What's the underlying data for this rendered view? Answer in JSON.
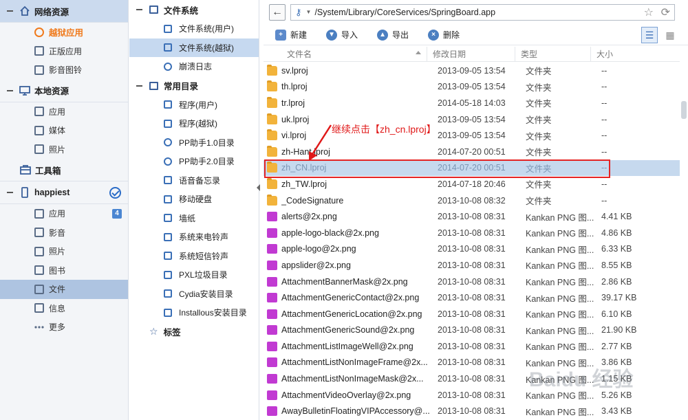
{
  "sidebar": {
    "sections": [
      {
        "label": "网络资源",
        "items": [
          "越狱应用",
          "正版应用",
          "影音图铃"
        ]
      },
      {
        "label": "本地资源",
        "items": [
          "应用",
          "媒体",
          "照片"
        ]
      },
      {
        "label": "工具箱",
        "items": []
      },
      {
        "label": "happiest",
        "items": [
          "应用",
          "影音",
          "照片",
          "图书",
          "文件",
          "信息",
          "更多"
        ],
        "badge": "4"
      }
    ]
  },
  "tree": {
    "filesystem_label": "文件系统",
    "filesystem_items": [
      "文件系统(用户)",
      "文件系统(越狱)",
      "崩溃日志"
    ],
    "common_label": "常用目录",
    "common_items": [
      "程序(用户)",
      "程序(越狱)",
      "PP助手1.0目录",
      "PP助手2.0目录",
      "语音备忘录",
      "移动硬盘",
      "墙纸",
      "系统来电铃声",
      "系统短信铃声",
      "PXL垃圾目录",
      "Cydia安装目录",
      "Installous安装目录"
    ],
    "bookmarks_label": "标签"
  },
  "address": {
    "path": "/System/Library/CoreServices/SpringBoard.app"
  },
  "toolbar": {
    "new_label": "新建",
    "import_label": "导入",
    "export_label": "导出",
    "delete_label": "删除"
  },
  "columns": {
    "name": "文件名",
    "date": "修改日期",
    "type": "类型",
    "size": "大小"
  },
  "files": [
    {
      "name": "sv.lproj",
      "date": "2013-09-05 13:54",
      "type": "文件夹",
      "size": "--",
      "kind": "folder"
    },
    {
      "name": "th.lproj",
      "date": "2013-09-05 13:54",
      "type": "文件夹",
      "size": "--",
      "kind": "folder"
    },
    {
      "name": "tr.lproj",
      "date": "2014-05-18 14:03",
      "type": "文件夹",
      "size": "--",
      "kind": "folder"
    },
    {
      "name": "uk.lproj",
      "date": "2013-09-05 13:54",
      "type": "文件夹",
      "size": "--",
      "kind": "folder"
    },
    {
      "name": "vi.lproj",
      "date": "2013-09-05 13:54",
      "type": "文件夹",
      "size": "--",
      "kind": "folder"
    },
    {
      "name": "zh-Hant.lproj",
      "date": "2014-07-20 00:51",
      "type": "文件夹",
      "size": "--",
      "kind": "folder"
    },
    {
      "name": "zh_CN.lproj",
      "date": "2014-07-20 00:51",
      "type": "文件夹",
      "size": "--",
      "kind": "folder"
    },
    {
      "name": "zh_TW.lproj",
      "date": "2014-07-18 20:46",
      "type": "文件夹",
      "size": "--",
      "kind": "folder"
    },
    {
      "name": "_CodeSignature",
      "date": "2013-10-08 08:32",
      "type": "文件夹",
      "size": "--",
      "kind": "folder"
    },
    {
      "name": "alerts@2x.png",
      "date": "2013-10-08 08:31",
      "type": "Kankan PNG 图...",
      "size": "4.41 KB",
      "kind": "png"
    },
    {
      "name": "apple-logo-black@2x.png",
      "date": "2013-10-08 08:31",
      "type": "Kankan PNG 图...",
      "size": "4.86 KB",
      "kind": "png"
    },
    {
      "name": "apple-logo@2x.png",
      "date": "2013-10-08 08:31",
      "type": "Kankan PNG 图...",
      "size": "6.33 KB",
      "kind": "png"
    },
    {
      "name": "appslider@2x.png",
      "date": "2013-10-08 08:31",
      "type": "Kankan PNG 图...",
      "size": "8.55 KB",
      "kind": "png"
    },
    {
      "name": "AttachmentBannerMask@2x.png",
      "date": "2013-10-08 08:31",
      "type": "Kankan PNG 图...",
      "size": "2.86 KB",
      "kind": "png"
    },
    {
      "name": "AttachmentGenericContact@2x.png",
      "date": "2013-10-08 08:31",
      "type": "Kankan PNG 图...",
      "size": "39.17 KB",
      "kind": "png"
    },
    {
      "name": "AttachmentGenericLocation@2x.png",
      "date": "2013-10-08 08:31",
      "type": "Kankan PNG 图...",
      "size": "6.10 KB",
      "kind": "png"
    },
    {
      "name": "AttachmentGenericSound@2x.png",
      "date": "2013-10-08 08:31",
      "type": "Kankan PNG 图...",
      "size": "21.90 KB",
      "kind": "png"
    },
    {
      "name": "AttachmentListImageWell@2x.png",
      "date": "2013-10-08 08:31",
      "type": "Kankan PNG 图...",
      "size": "2.77 KB",
      "kind": "png"
    },
    {
      "name": "AttachmentListNonImageFrame@2x...",
      "date": "2013-10-08 08:31",
      "type": "Kankan PNG 图...",
      "size": "3.86 KB",
      "kind": "png"
    },
    {
      "name": "AttachmentListNonImageMask@2x...",
      "date": "2013-10-08 08:31",
      "type": "Kankan PNG 图...",
      "size": "1.15 KB",
      "kind": "png"
    },
    {
      "name": "AttachmentVideoOverlay@2x.png",
      "date": "2013-10-08 08:31",
      "type": "Kankan PNG 图...",
      "size": "5.26 KB",
      "kind": "png"
    },
    {
      "name": "AwayBulletinFloatingVIPAccessory@...",
      "date": "2013-10-08 08:31",
      "type": "Kankan PNG 图...",
      "size": "3.43 KB",
      "kind": "png"
    }
  ],
  "annotation": {
    "text": "继续点击【zh_cn.lproj】",
    "color": "#e01818"
  },
  "watermark": "Baidu 经验",
  "colors": {
    "accent": "#4b86d2",
    "highlight": "#f07a1c",
    "selection": "#c6d9ee"
  }
}
